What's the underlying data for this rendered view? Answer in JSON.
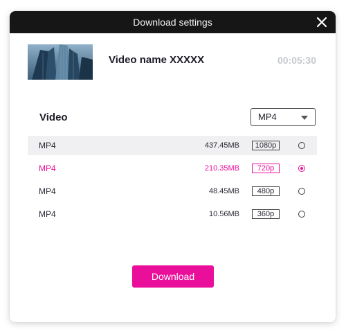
{
  "dialog": {
    "title": "Download settings"
  },
  "video": {
    "name": "Video name XXXXX",
    "duration": "00:05:30"
  },
  "section": {
    "label": "Video",
    "format_select": "MP4"
  },
  "rows": [
    {
      "format": "MP4",
      "size": "437.45MB",
      "resolution": "1080p",
      "selected": false
    },
    {
      "format": "MP4",
      "size": "210.35MB",
      "resolution": "720p",
      "selected": true
    },
    {
      "format": "MP4",
      "size": "48.45MB",
      "resolution": "480p",
      "selected": false
    },
    {
      "format": "MP4",
      "size": "10.56MB",
      "resolution": "360p",
      "selected": false
    }
  ],
  "actions": {
    "download_label": "Download"
  },
  "colors": {
    "accent": "#ea0f9a",
    "titlebar": "#161616"
  }
}
